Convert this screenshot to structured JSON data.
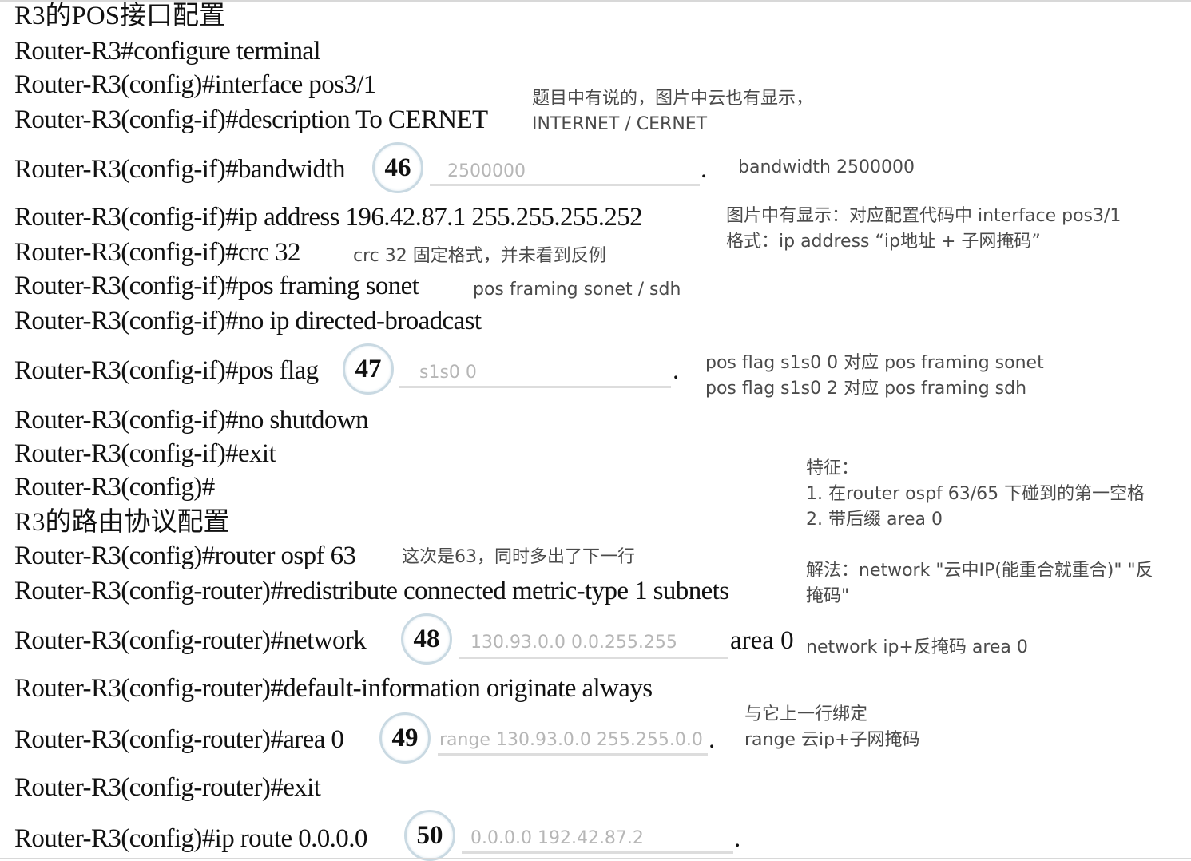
{
  "headings": {
    "pos_config": "R3的POS接口配置",
    "routing_config": "R3的路由协议配置"
  },
  "commands": {
    "c1": "Router-R3#configure terminal",
    "c2": "Router-R3(config)#interface pos3/1",
    "c3": "Router-R3(config-if)#description To CERNET",
    "c4": "Router-R3(config-if)#bandwidth",
    "c5": "Router-R3(config-if)#ip address 196.42.87.1 255.255.255.252",
    "c6": "Router-R3(config-if)#crc 32",
    "c7": "Router-R3(config-if)#pos framing sonet",
    "c8": "Router-R3(config-if)#no ip directed-broadcast",
    "c9": "Router-R3(config-if)#pos flag",
    "c10": "Router-R3(config-if)#no shutdown",
    "c11": "Router-R3(config-if)#exit",
    "c12": "Router-R3(config)#",
    "c13": "Router-R3(config)#router ospf 63",
    "c14": "Router-R3(config-router)#redistribute connected metric-type 1 subnets",
    "c15": "Router-R3(config-router)#network",
    "c15_tail": "area 0",
    "c16": "Router-R3(config-router)#default-information originate always",
    "c17": "Router-R3(config-router)#area 0",
    "c18": "Router-R3(config-router)#exit",
    "c19": "Router-R3(config)#ip route 0.0.0.0"
  },
  "blanks": [
    {
      "number": "46",
      "answer": "2500000",
      "end": "."
    },
    {
      "number": "47",
      "answer": "s1s0 0",
      "end": "."
    },
    {
      "number": "48",
      "answer": "130.93.0.0 0.0.255.255",
      "end": ""
    },
    {
      "number": "49",
      "answer": "range 130.93.0.0 255.255.0.0",
      "end": "."
    },
    {
      "number": "50",
      "answer": "0.0.0.0 192.42.87.2",
      "end": "."
    }
  ],
  "notes": {
    "n1_line1": "题目中有说的，图片中云也有显示，",
    "n1_line2": "INTERNET / CERNET",
    "n2": "bandwidth 2500000",
    "n3_line1": "图片中有显示：对应配置代码中 interface pos3/1",
    "n3_line2": "格式：ip address  “ip地址 + 子网掩码”",
    "n4": "crc 32 固定格式，并未看到反例",
    "n5": "pos framing sonet / sdh",
    "n6_line1": "pos flag s1s0 0 对应 pos framing sonet",
    "n6_line2": "pos flag s1s0 2 对应 pos framing sdh",
    "n7_line1": "特征：",
    "n7_line2": "1. 在router ospf 63/65 下碰到的第一空格",
    "n7_line3": "2. 带后缀 area 0",
    "n8": "这次是63，同时多出了下一行",
    "n9_line1": "解法：network \"云中IP(能重合就重合)\" \"反",
    "n9_line2": "掩码\"",
    "n10": "network ip+反掩码 area 0",
    "n11_line1": "与它上一行绑定",
    "n11_line2": "range 云ip+子网掩码"
  }
}
